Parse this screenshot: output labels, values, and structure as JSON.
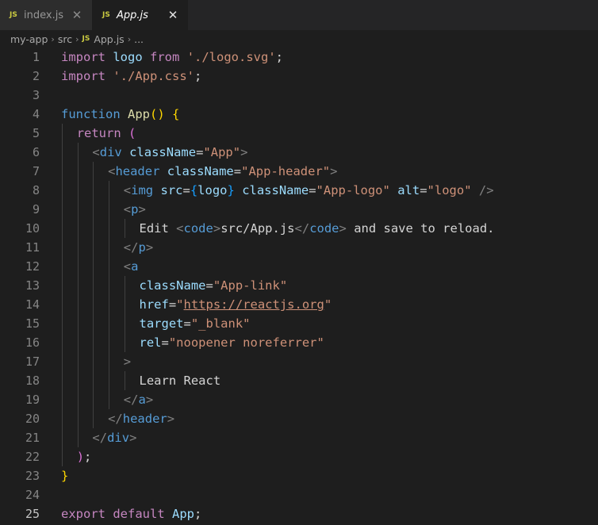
{
  "tabs": [
    {
      "icon": "JS",
      "label": "index.js",
      "active": false,
      "close": "✕"
    },
    {
      "icon": "JS",
      "label": "App.js",
      "active": true,
      "close": "✕"
    }
  ],
  "breadcrumb": {
    "parts": [
      "my-app",
      "src"
    ],
    "separator": "›",
    "file_icon": "JS",
    "file": "App.js",
    "tail": "..."
  },
  "colors": {
    "background": "#1e1e1e",
    "tabbar": "#252526",
    "keyword": "#c586c0",
    "function": "#dcdcaa",
    "variable": "#9cdcfe",
    "string": "#ce9178",
    "tag": "#569cd6",
    "js_icon": "#cbcb41"
  },
  "code": {
    "current_line": 25,
    "lines": [
      {
        "num": "1",
        "indent": 0,
        "tokens": [
          [
            "kw",
            "import"
          ],
          [
            "txt",
            " "
          ],
          [
            "var",
            "logo"
          ],
          [
            "txt",
            " "
          ],
          [
            "kw",
            "from"
          ],
          [
            "txt",
            " "
          ],
          [
            "str",
            "'./logo.svg'"
          ],
          [
            "pn",
            ";"
          ]
        ]
      },
      {
        "num": "2",
        "indent": 0,
        "tokens": [
          [
            "kw",
            "import"
          ],
          [
            "txt",
            " "
          ],
          [
            "str",
            "'./App.css'"
          ],
          [
            "pn",
            ";"
          ]
        ]
      },
      {
        "num": "3",
        "indent": 0,
        "tokens": []
      },
      {
        "num": "4",
        "indent": 0,
        "tokens": [
          [
            "tag",
            "function"
          ],
          [
            "txt",
            " "
          ],
          [
            "fn",
            "App"
          ],
          [
            "b1",
            "()"
          ],
          [
            "txt",
            " "
          ],
          [
            "b1",
            "{"
          ]
        ]
      },
      {
        "num": "5",
        "indent": 1,
        "tokens": [
          [
            "kw",
            "return"
          ],
          [
            "txt",
            " "
          ],
          [
            "b2",
            "("
          ]
        ]
      },
      {
        "num": "6",
        "indent": 2,
        "tokens": [
          [
            "br",
            "<"
          ],
          [
            "tag",
            "div"
          ],
          [
            "txt",
            " "
          ],
          [
            "attr",
            "className"
          ],
          [
            "pn",
            "="
          ],
          [
            "str",
            "\"App\""
          ],
          [
            "br",
            ">"
          ]
        ]
      },
      {
        "num": "7",
        "indent": 3,
        "tokens": [
          [
            "br",
            "<"
          ],
          [
            "tag",
            "header"
          ],
          [
            "txt",
            " "
          ],
          [
            "attr",
            "className"
          ],
          [
            "pn",
            "="
          ],
          [
            "str",
            "\"App-header\""
          ],
          [
            "br",
            ">"
          ]
        ]
      },
      {
        "num": "8",
        "indent": 4,
        "tokens": [
          [
            "br",
            "<"
          ],
          [
            "tag",
            "img"
          ],
          [
            "txt",
            " "
          ],
          [
            "attr",
            "src"
          ],
          [
            "pn",
            "="
          ],
          [
            "b3",
            "{"
          ],
          [
            "var",
            "logo"
          ],
          [
            "b3",
            "}"
          ],
          [
            "txt",
            " "
          ],
          [
            "attr",
            "className"
          ],
          [
            "pn",
            "="
          ],
          [
            "str",
            "\"App-logo\""
          ],
          [
            "txt",
            " "
          ],
          [
            "attr",
            "alt"
          ],
          [
            "pn",
            "="
          ],
          [
            "str",
            "\"logo\""
          ],
          [
            "txt",
            " "
          ],
          [
            "br",
            "/>"
          ]
        ]
      },
      {
        "num": "9",
        "indent": 4,
        "tokens": [
          [
            "br",
            "<"
          ],
          [
            "tag",
            "p"
          ],
          [
            "br",
            ">"
          ]
        ]
      },
      {
        "num": "10",
        "indent": 5,
        "tokens": [
          [
            "txt",
            "Edit "
          ],
          [
            "br",
            "<"
          ],
          [
            "tag",
            "code"
          ],
          [
            "br",
            ">"
          ],
          [
            "txt",
            "src/App.js"
          ],
          [
            "br",
            "</"
          ],
          [
            "tag",
            "code"
          ],
          [
            "br",
            ">"
          ],
          [
            "txt",
            " and save to reload."
          ]
        ]
      },
      {
        "num": "11",
        "indent": 4,
        "tokens": [
          [
            "br",
            "</"
          ],
          [
            "tag",
            "p"
          ],
          [
            "br",
            ">"
          ]
        ]
      },
      {
        "num": "12",
        "indent": 4,
        "tokens": [
          [
            "br",
            "<"
          ],
          [
            "tag",
            "a"
          ]
        ]
      },
      {
        "num": "13",
        "indent": 5,
        "tokens": [
          [
            "attr",
            "className"
          ],
          [
            "pn",
            "="
          ],
          [
            "str",
            "\"App-link\""
          ]
        ]
      },
      {
        "num": "14",
        "indent": 5,
        "tokens": [
          [
            "attr",
            "href"
          ],
          [
            "pn",
            "="
          ],
          [
            "str",
            "\""
          ],
          [
            "link",
            "https://reactjs.org"
          ],
          [
            "str",
            "\""
          ]
        ]
      },
      {
        "num": "15",
        "indent": 5,
        "tokens": [
          [
            "attr",
            "target"
          ],
          [
            "pn",
            "="
          ],
          [
            "str",
            "\"_blank\""
          ]
        ]
      },
      {
        "num": "16",
        "indent": 5,
        "tokens": [
          [
            "attr",
            "rel"
          ],
          [
            "pn",
            "="
          ],
          [
            "str",
            "\"noopener noreferrer\""
          ]
        ]
      },
      {
        "num": "17",
        "indent": 4,
        "tokens": [
          [
            "br",
            ">"
          ]
        ]
      },
      {
        "num": "18",
        "indent": 5,
        "tokens": [
          [
            "txt",
            "Learn React"
          ]
        ]
      },
      {
        "num": "19",
        "indent": 4,
        "tokens": [
          [
            "br",
            "</"
          ],
          [
            "tag",
            "a"
          ],
          [
            "br",
            ">"
          ]
        ]
      },
      {
        "num": "20",
        "indent": 3,
        "tokens": [
          [
            "br",
            "</"
          ],
          [
            "tag",
            "header"
          ],
          [
            "br",
            ">"
          ]
        ]
      },
      {
        "num": "21",
        "indent": 2,
        "tokens": [
          [
            "br",
            "</"
          ],
          [
            "tag",
            "div"
          ],
          [
            "br",
            ">"
          ]
        ]
      },
      {
        "num": "22",
        "indent": 1,
        "tokens": [
          [
            "b2",
            ")"
          ],
          [
            "pn",
            ";"
          ]
        ]
      },
      {
        "num": "23",
        "indent": 0,
        "tokens": [
          [
            "b1",
            "}"
          ]
        ]
      },
      {
        "num": "24",
        "indent": 0,
        "tokens": []
      },
      {
        "num": "25",
        "indent": 0,
        "tokens": [
          [
            "kw",
            "export"
          ],
          [
            "txt",
            " "
          ],
          [
            "kw",
            "default"
          ],
          [
            "txt",
            " "
          ],
          [
            "var",
            "App"
          ],
          [
            "pn",
            ";"
          ]
        ]
      }
    ]
  }
}
